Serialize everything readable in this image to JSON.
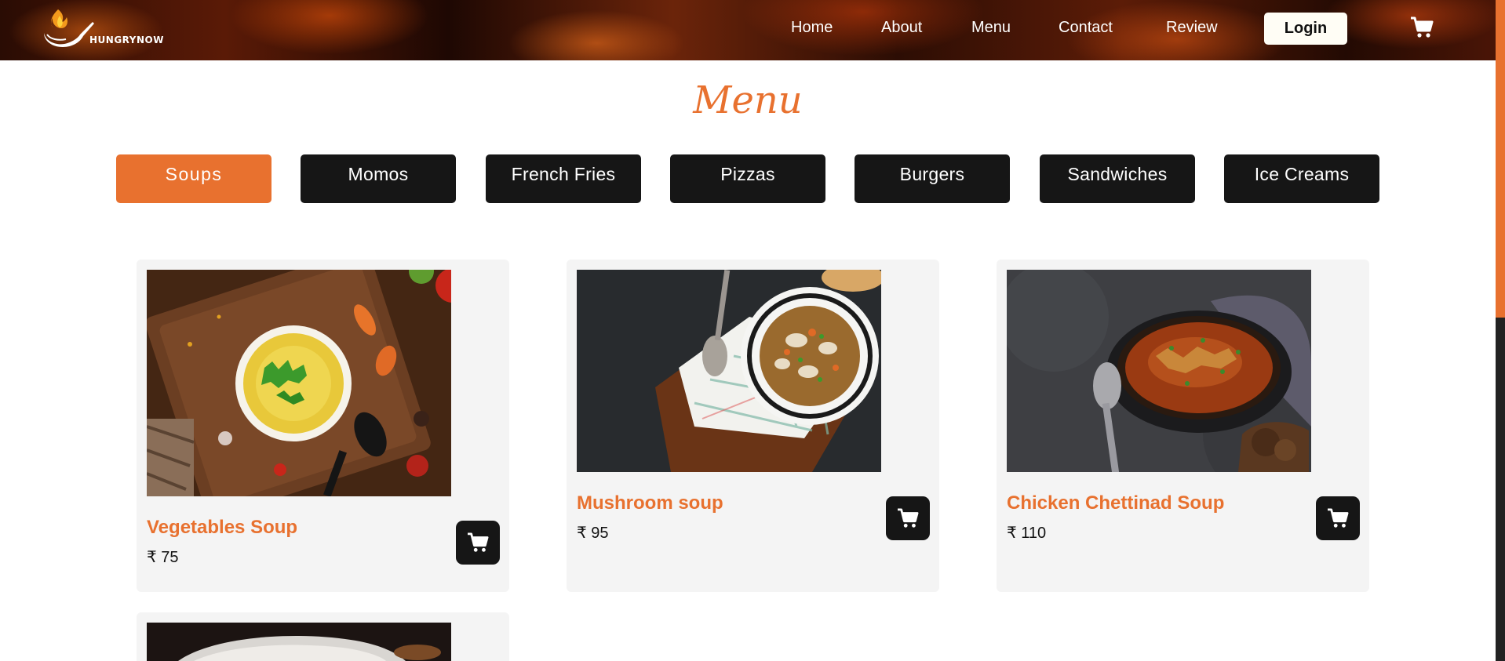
{
  "brand": {
    "name": "HUNGRYNOW"
  },
  "nav": {
    "items": [
      "Home",
      "About",
      "Menu",
      "Contact",
      "Review"
    ],
    "login_label": "Login"
  },
  "page": {
    "title": "Menu"
  },
  "categories": {
    "items": [
      "Soups",
      "Momos",
      "French Fries",
      "Pizzas",
      "Burgers",
      "Sandwiches",
      "Ice Creams"
    ],
    "active": "Soups"
  },
  "products": [
    {
      "name": "Vegetables Soup",
      "price": "₹ 75",
      "image": "vegetable-soup-photo"
    },
    {
      "name": "Mushroom soup",
      "price": "₹ 95",
      "image": "mushroom-soup-photo"
    },
    {
      "name": "Chicken Chettinad Soup",
      "price": "₹ 110",
      "image": "chicken-soup-photo"
    },
    {
      "name": "",
      "price": "",
      "image": "soup-photo"
    }
  ],
  "colors": {
    "accent": "#e8712f",
    "dark": "#161616",
    "card_bg": "#f4f4f4"
  },
  "icons": {
    "cart": "cart-icon"
  }
}
